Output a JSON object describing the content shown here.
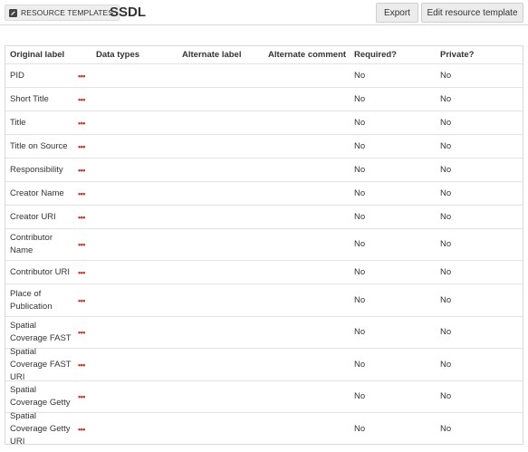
{
  "header": {
    "breadcrumb_label": "RESOURCE TEMPLATES",
    "breadcrumb_icon": "pencil-square-icon",
    "title": "SSDL",
    "export_label": "Export",
    "edit_label": "Edit resource template"
  },
  "colors": {
    "accent_dots": "#c0392b",
    "button_bg": "#ececec",
    "border": "#dadada"
  },
  "table": {
    "columns": [
      "Original label",
      "Data types",
      "Alternate label",
      "Alternate comment",
      "Required?",
      "Private?"
    ],
    "rows": [
      {
        "label": "PID",
        "data_types": "",
        "alt_label": "",
        "alt_comment": "",
        "required": "No",
        "private": "No"
      },
      {
        "label": "Short Title",
        "data_types": "",
        "alt_label": "",
        "alt_comment": "",
        "required": "No",
        "private": "No"
      },
      {
        "label": "Title",
        "data_types": "",
        "alt_label": "",
        "alt_comment": "",
        "required": "No",
        "private": "No"
      },
      {
        "label": "Title on Source",
        "data_types": "",
        "alt_label": "",
        "alt_comment": "",
        "required": "No",
        "private": "No"
      },
      {
        "label": "Responsibility",
        "data_types": "",
        "alt_label": "",
        "alt_comment": "",
        "required": "No",
        "private": "No"
      },
      {
        "label": "Creator Name",
        "data_types": "",
        "alt_label": "",
        "alt_comment": "",
        "required": "No",
        "private": "No"
      },
      {
        "label": "Creator URI",
        "data_types": "",
        "alt_label": "",
        "alt_comment": "",
        "required": "No",
        "private": "No"
      },
      {
        "label": "Contributor Name",
        "data_types": "",
        "alt_label": "",
        "alt_comment": "",
        "required": "No",
        "private": "No"
      },
      {
        "label": "Contributor URI",
        "data_types": "",
        "alt_label": "",
        "alt_comment": "",
        "required": "No",
        "private": "No"
      },
      {
        "label": "Place of Publication",
        "data_types": "",
        "alt_label": "",
        "alt_comment": "",
        "required": "No",
        "private": "No"
      },
      {
        "label": "Spatial Coverage FAST",
        "data_types": "",
        "alt_label": "",
        "alt_comment": "",
        "required": "No",
        "private": "No"
      },
      {
        "label": "Spatial Coverage FAST URI",
        "data_types": "",
        "alt_label": "",
        "alt_comment": "",
        "required": "No",
        "private": "No"
      },
      {
        "label": "Spatial Coverage Getty",
        "data_types": "",
        "alt_label": "",
        "alt_comment": "",
        "required": "No",
        "private": "No"
      },
      {
        "label": "Spatial Coverage Getty URI",
        "data_types": "",
        "alt_label": "",
        "alt_comment": "",
        "required": "No",
        "private": "No"
      }
    ]
  }
}
